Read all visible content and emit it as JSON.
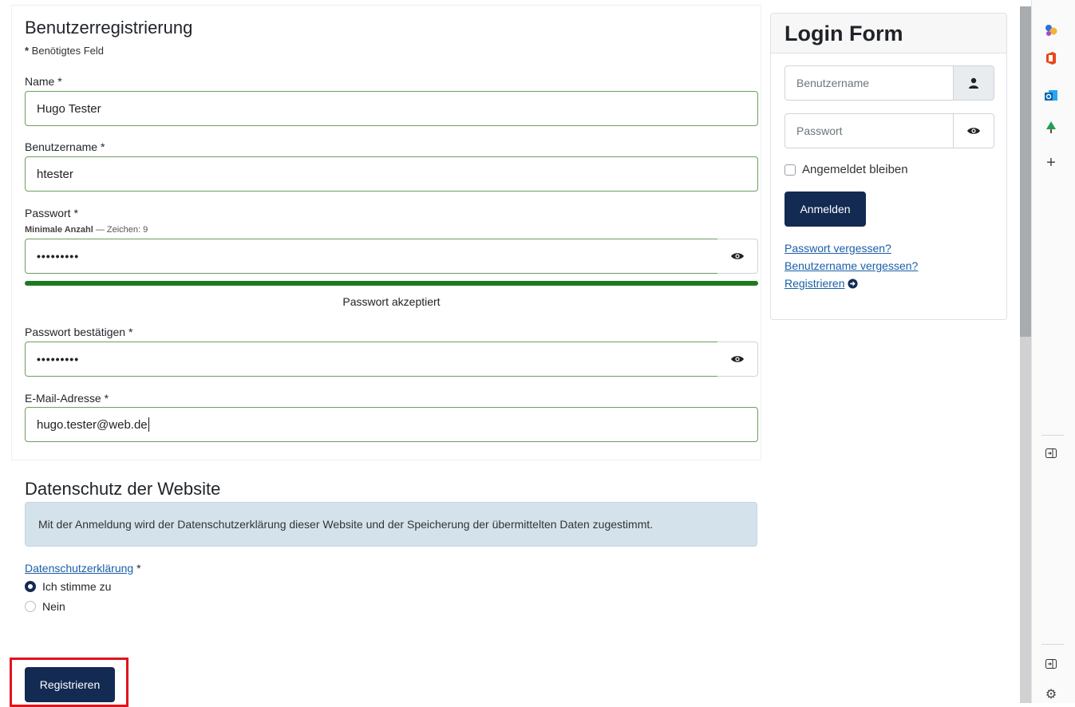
{
  "registration": {
    "title": "Benutzerregistrierung",
    "required_star": "*",
    "required_note": " Benötigtes Feld",
    "name_label": "Name *",
    "name_value": "Hugo Tester",
    "username_label": "Benutzername *",
    "username_value": "htester",
    "password_label": "Passwort *",
    "password_hint_strong": "Minimale Anzahl",
    "password_hint_rest": " — Zeichen: 9",
    "password_value": "•••••••••",
    "password_strength_fraction": 1.0,
    "password_strength_text": "Passwort akzeptiert",
    "confirm_label": "Passwort bestätigen *",
    "confirm_value": "•••••••••",
    "email_label": "E-Mail-Adresse *",
    "email_value": "hugo.tester@web.de"
  },
  "privacy": {
    "title": "Datenschutz der Website",
    "notice": "Mit der Anmeldung wird der Datenschutzerklärung dieser Website und der Speicherung der übermittelten Daten zugestimmt.",
    "link_label": "Datenschutzerklärung",
    "link_suffix": " *",
    "option_agree": "Ich stimme zu",
    "option_decline": "Nein",
    "selected": "Ich stimme zu"
  },
  "register_button": "Registrieren",
  "login": {
    "title": "Login Form",
    "username_placeholder": "Benutzername",
    "password_placeholder": "Passwort",
    "remember_label": "Angemeldet bleiben",
    "remember_checked": false,
    "submit_label": "Anmelden",
    "forgot_password": "Passwort vergessen?",
    "forgot_username": "Benutzername vergessen?",
    "register_link": "Registrieren"
  },
  "sidebar_icons": [
    "copilot-icon",
    "office-icon",
    "outlook-icon",
    "tree-icon",
    "plus-icon",
    "sidebar-toggle-icon",
    "sidebar-toggle-icon",
    "settings-icon"
  ],
  "colors": {
    "primary": "#132a52",
    "valid_border": "#6c9f60",
    "strength_bar": "#1e7a1e",
    "alert_bg": "#d4e2ec",
    "link": "#1a5fa8",
    "highlight": "#e0141e"
  }
}
